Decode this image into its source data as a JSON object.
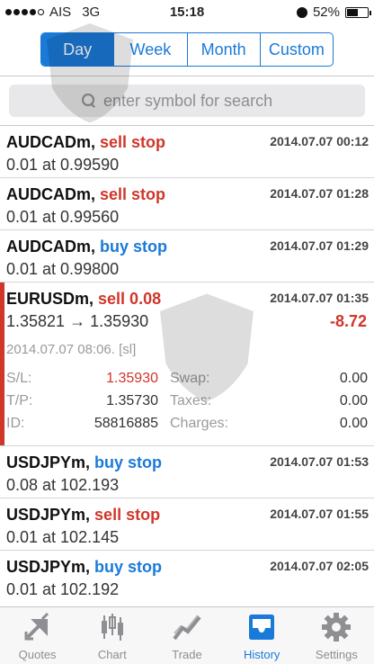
{
  "status_bar": {
    "carrier": "AIS",
    "network": "3G",
    "time": "15:18",
    "battery": "52%"
  },
  "period_tabs": [
    {
      "label": "Day",
      "active": true
    },
    {
      "label": "Week",
      "active": false
    },
    {
      "label": "Month",
      "active": false
    },
    {
      "label": "Custom",
      "active": false
    }
  ],
  "search": {
    "placeholder": "enter symbol for search"
  },
  "orders": [
    {
      "symbol": "AUDCADm",
      "action": "sell stop",
      "side": "sell",
      "time": "2014.07.07 00:12",
      "detail": "0.01 at 0.99590"
    },
    {
      "symbol": "AUDCADm",
      "action": "sell stop",
      "side": "sell",
      "time": "2014.07.07 01:28",
      "detail": "0.01 at 0.99560"
    },
    {
      "symbol": "AUDCADm",
      "action": "buy stop",
      "side": "buy",
      "time": "2014.07.07 01:29",
      "detail": "0.01 at 0.99800"
    }
  ],
  "deal": {
    "symbol": "EURUSDm",
    "action": "sell 0.08",
    "side": "sell",
    "time": "2014.07.07 01:35",
    "detail": "1.35821 → 1.35930",
    "profit": "-8.72",
    "close_info": "2014.07.07 08:06. [sl]",
    "sl_label": "S/L:",
    "sl_value": "1.35930",
    "tp_label": "T/P:",
    "tp_value": "1.35730",
    "id_label": "ID:",
    "id_value": "58816885",
    "swap_label": "Swap:",
    "swap_value": "0.00",
    "taxes_label": "Taxes:",
    "taxes_value": "0.00",
    "charges_label": "Charges:",
    "charges_value": "0.00"
  },
  "orders_after": [
    {
      "symbol": "USDJPYm",
      "action": "buy stop",
      "side": "buy",
      "time": "2014.07.07 01:53",
      "detail": "0.08 at 102.193"
    },
    {
      "symbol": "USDJPYm",
      "action": "sell stop",
      "side": "sell",
      "time": "2014.07.07 01:55",
      "detail": "0.01 at 102.145"
    },
    {
      "symbol": "USDJPYm",
      "action": "buy stop",
      "side": "buy",
      "time": "2014.07.07 02:05",
      "detail": "0.01 at 102.192"
    }
  ],
  "tabbar": [
    {
      "label": "Quotes",
      "icon": "quotes-arrows-icon",
      "active": false
    },
    {
      "label": "Chart",
      "icon": "candlestick-chart-icon",
      "active": false
    },
    {
      "label": "Trade",
      "icon": "trade-line-icon",
      "active": false
    },
    {
      "label": "History",
      "icon": "inbox-tray-icon",
      "active": true
    },
    {
      "label": "Settings",
      "icon": "gear-icon",
      "active": false
    }
  ],
  "colors": {
    "accent": "#1a7ad8",
    "sell": "#d0362a",
    "buy": "#1a7ad8"
  }
}
